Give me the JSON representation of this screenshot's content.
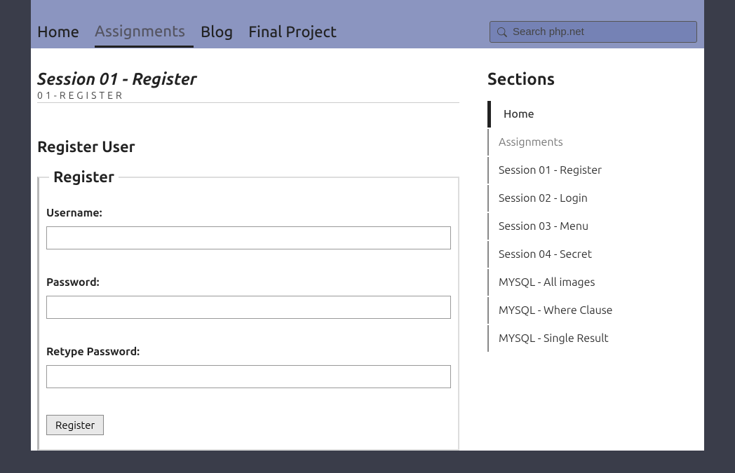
{
  "nav": {
    "items": [
      {
        "label": "Home",
        "active": false
      },
      {
        "label": "Assignments",
        "active": true
      },
      {
        "label": "Blog",
        "active": false
      },
      {
        "label": "Final Project",
        "active": false
      }
    ]
  },
  "search": {
    "placeholder": "Search php.net"
  },
  "page": {
    "title": "Session 01 - Register",
    "subtitle": "01-REGISTER"
  },
  "form": {
    "heading": "Register User",
    "legend": "Register",
    "username_label": "Username:",
    "password_label": "Password:",
    "retype_label": "Retype Password:",
    "submit_label": "Register"
  },
  "sidebar": {
    "title": "Sections",
    "items": [
      {
        "label": "Home",
        "active": true,
        "dim": false
      },
      {
        "label": "Assignments",
        "active": false,
        "dim": true
      },
      {
        "label": "Session 01 - Register",
        "active": false,
        "dim": false
      },
      {
        "label": "Session 02 - Login",
        "active": false,
        "dim": false
      },
      {
        "label": "Session 03 - Menu",
        "active": false,
        "dim": false
      },
      {
        "label": "Session 04 - Secret",
        "active": false,
        "dim": false
      },
      {
        "label": "MYSQL - All images",
        "active": false,
        "dim": false
      },
      {
        "label": "MYSQL - Where Clause",
        "active": false,
        "dim": false
      },
      {
        "label": "MYSQL - Single Result",
        "active": false,
        "dim": false
      }
    ]
  }
}
